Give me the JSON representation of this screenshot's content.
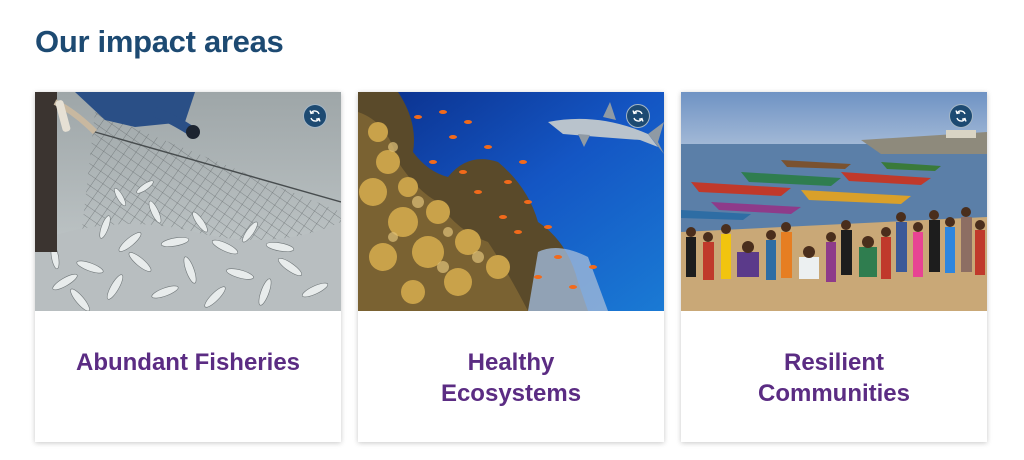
{
  "section": {
    "heading": "Our impact areas"
  },
  "cards": [
    {
      "title": "Abundant Fisheries",
      "image": "fishing-net-catch-photo",
      "action_icon": "flip-refresh-icon"
    },
    {
      "title": "Healthy Ecosystems",
      "image": "coral-reef-shark-photo",
      "action_icon": "flip-refresh-icon"
    },
    {
      "title": "Resilient Communities",
      "image": "beach-fishing-community-photo",
      "action_icon": "flip-refresh-icon"
    }
  ],
  "colors": {
    "heading": "#1d4a72",
    "card_title": "#5b2c83",
    "button": "#1d4a72"
  }
}
